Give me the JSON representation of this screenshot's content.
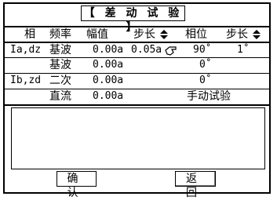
{
  "title": "【 差 动 试 验 】",
  "headers": {
    "phase": "相",
    "freq": "频率",
    "amp": "幅值",
    "step1": "步长",
    "angle": "相位",
    "step2": "步长"
  },
  "rows": [
    {
      "phase": "Ia,dz",
      "freq": "基波",
      "amp": "0.00a",
      "step": "0.05a",
      "angle": "90˚",
      "angle_step": "1˚"
    },
    {
      "phase": "",
      "freq": "基波",
      "amp": "0.00a",
      "angle": "0˚"
    },
    {
      "phase": "Ib,zd",
      "freq": "二次",
      "amp": "0.00a",
      "angle": "0˚"
    },
    {
      "phase": "",
      "freq": "直流",
      "amp": "0.00a",
      "mode": "手动试验"
    }
  ],
  "buttons": {
    "confirm": "确 认",
    "back": "返 回"
  },
  "icons": {
    "sort": "up-down-arrows-icon",
    "cursor": "hand-pointer-icon"
  }
}
